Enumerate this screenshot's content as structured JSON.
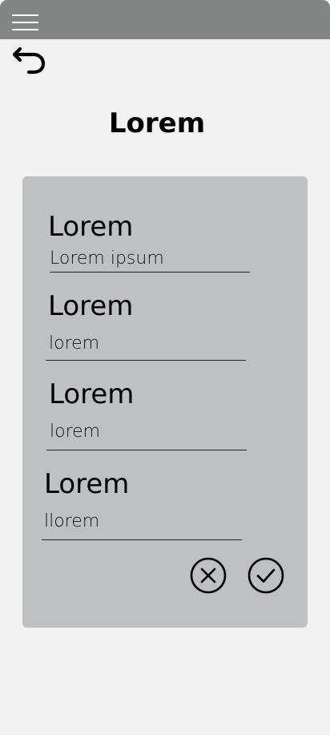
{
  "header": {
    "menu_icon": "hamburger-menu-icon"
  },
  "nav": {
    "back_icon": "back-arrow-icon"
  },
  "page": {
    "title": "Lorem"
  },
  "form": {
    "fields": [
      {
        "label": "Lorem",
        "value": "Lorem ipsum"
      },
      {
        "label": "Lorem",
        "value": "lorem"
      },
      {
        "label": "Lorem",
        "value": "lorem"
      },
      {
        "label": "Lorem",
        "value": "llorem"
      }
    ],
    "actions": {
      "cancel_icon": "cancel-circle-icon",
      "confirm_icon": "check-circle-icon"
    }
  }
}
